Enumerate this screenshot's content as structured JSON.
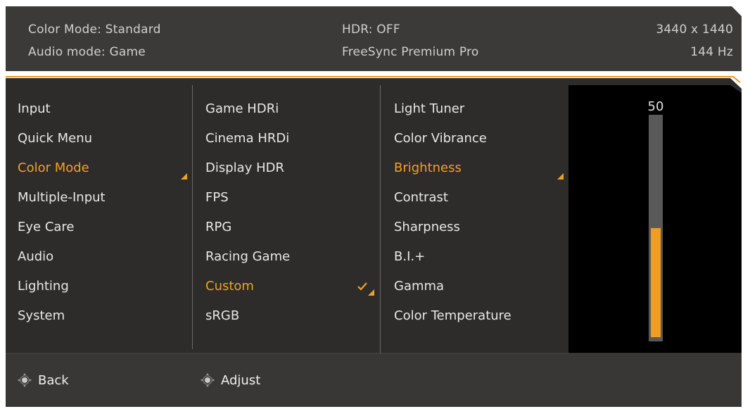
{
  "header": {
    "color_mode": "Color Mode: Standard",
    "audio_mode": "Audio mode: Game",
    "hdr": "HDR: OFF",
    "freesync": "FreeSync Premium Pro",
    "resolution": "3440 x 1440",
    "refresh_rate": "144 Hz"
  },
  "menu_level1": [
    {
      "label": "Input"
    },
    {
      "label": "Quick Menu"
    },
    {
      "label": "Color Mode",
      "active": true
    },
    {
      "label": "Multiple-Input"
    },
    {
      "label": "Eye Care"
    },
    {
      "label": "Audio"
    },
    {
      "label": "Lighting"
    },
    {
      "label": "System"
    }
  ],
  "menu_level2": [
    {
      "label": "Game HDRi"
    },
    {
      "label": "Cinema HRDi"
    },
    {
      "label": "Display HDR"
    },
    {
      "label": "FPS"
    },
    {
      "label": "RPG"
    },
    {
      "label": "Racing Game"
    },
    {
      "label": "Custom",
      "active": true,
      "checked": true
    },
    {
      "label": "sRGB"
    }
  ],
  "menu_level3": [
    {
      "label": "Light Tuner"
    },
    {
      "label": "Color Vibrance"
    },
    {
      "label": "Brightness",
      "active": true
    },
    {
      "label": "Contrast"
    },
    {
      "label": "Sharpness"
    },
    {
      "label": "B.I.+"
    },
    {
      "label": "Gamma"
    },
    {
      "label": "Color Temperature"
    }
  ],
  "brightness_slider": {
    "value_label": "50",
    "value": 50,
    "max": 100
  },
  "footer": {
    "back_label": "Back",
    "adjust_label": "Adjust"
  },
  "colors": {
    "accent": "#f3a024",
    "panel": "#2b2a28",
    "header": "#3a3937",
    "footer": "#363533",
    "text": "#e8e8e8"
  },
  "icons": {
    "joystick": "joystick-icon",
    "checkmark": "checkmark-icon",
    "selection_arrow": "selection-arrow-icon"
  }
}
